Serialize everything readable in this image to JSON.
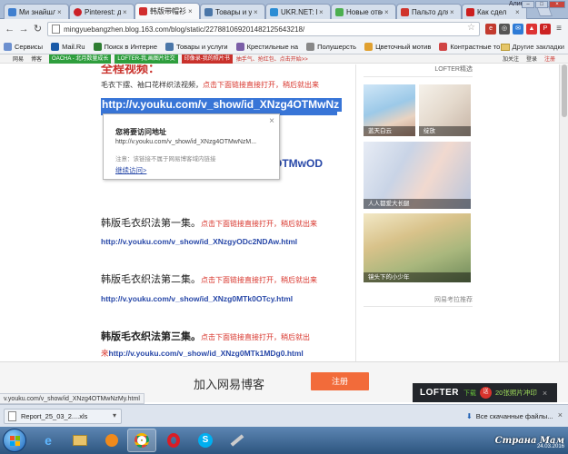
{
  "browser": {
    "user": "Алина",
    "tabs": [
      {
        "title": "Ми знайшли",
        "color": "#3f7fcf"
      },
      {
        "title": "Pinterest: ди",
        "color": "#cb2027"
      },
      {
        "title": "韩版带帽衫",
        "color": "#d12d2d"
      },
      {
        "title": "Товары и ус",
        "color": "#4a76a8"
      },
      {
        "title": "UKR.NET: Вс",
        "color": "#2a8cd4"
      },
      {
        "title": "Новые отве",
        "color": "#4caf50"
      },
      {
        "title": "Пальто для",
        "color": "#d0342c"
      },
      {
        "title": "Как сдел",
        "color": "#cc1f1f"
      }
    ],
    "url": "mingyuebangzhen.blog.163.com/blog/static/227881069201482125643218/",
    "bookmarks": [
      {
        "label": "Сервисы",
        "color": "#6b8fcf"
      },
      {
        "label": "Mail.Ru",
        "color": "#1a5aa8"
      },
      {
        "label": "Поиск в Интерне",
        "color": "#2e7d32"
      },
      {
        "label": "Товары и услуги",
        "color": "#4a76a8"
      },
      {
        "label": "Крестильные на",
        "color": "#7b5ea7"
      },
      {
        "label": "Полушерсть",
        "color": "#888888"
      },
      {
        "label": "Цветочный мотив",
        "color": "#e0a030"
      },
      {
        "label": "Контрастные то",
        "color": "#d04444"
      }
    ],
    "other_bookmarks": "Другие закладки",
    "status_url": "v.youku.com/v_show/id_XNzg4OTMwNzMy.html"
  },
  "site_nav": {
    "items": [
      "网易",
      "博客"
    ],
    "promo1": "OACHA - 北月数量成长",
    "promo2": "LOFTER-我,画图片社交",
    "promo3": "印像录-我的照片书",
    "hot": "抽手气、抢红包、点击开始>>",
    "right": [
      "加关注",
      "登录",
      "注册"
    ]
  },
  "post": {
    "heading": "全程视频：",
    "intro_text": "毛衣下摆、袖口花样织法视频，",
    "intro_red": "点击下面链接直接打开，稍后就出来",
    "link_selected": "http://v.youku.com/v_show/id_XNzg4OTMwNz",
    "link_partial": "g4OTMwOD",
    "sections": [
      {
        "title": "韩版毛衣织法第一集",
        "note": "点击下面链接直接打开，稍后就出来",
        "link": "http://v.youku.com/v_show/id_XNzgyODc2NDAw.html",
        "link_prefix": ""
      },
      {
        "title": "韩版毛衣织法第二集",
        "note": "点击下面链接直接打开，稍后就出来",
        "link": "http://v.youku.com/v_show/id_XNzg0MTk0OTcy.html",
        "link_prefix": ""
      },
      {
        "title": "韩版毛衣织法第三集",
        "note": "点击下面链接直接打开，稍后就出",
        "link": "http://v.youku.com/v_show/id_XNzg0MTk1MDg0.html",
        "link_prefix": "来"
      }
    ],
    "sep": "。"
  },
  "popup": {
    "title": "您将要访问地址",
    "url": "http://v.youku.com/v_show/id_XNzg4OTMwNzM...",
    "note": "注意：该链接不属于网易博客域内链接",
    "continue": "继续访问>"
  },
  "sidebar": {
    "header": "LOFTER精选",
    "photos": [
      {
        "caption": "蓝天白云"
      },
      {
        "caption": "绽放"
      },
      {
        "caption": "人人都爱大长腿"
      },
      {
        "caption": "镜头下的小少年"
      }
    ],
    "more": "网易考拉推荐"
  },
  "banner": {
    "text": "加入网易博客",
    "join": "注册",
    "lofter_brand": "LOFTER",
    "lofter_dl": "下载",
    "lofter_gift": "送",
    "lofter_promo": "20张照片冲印"
  },
  "downloads": {
    "file": "Report_25_03_2....xls",
    "all": "Все скачанные файлы..."
  },
  "taskbar": {
    "site": "Страна Мам",
    "date": "24.03.2016"
  }
}
